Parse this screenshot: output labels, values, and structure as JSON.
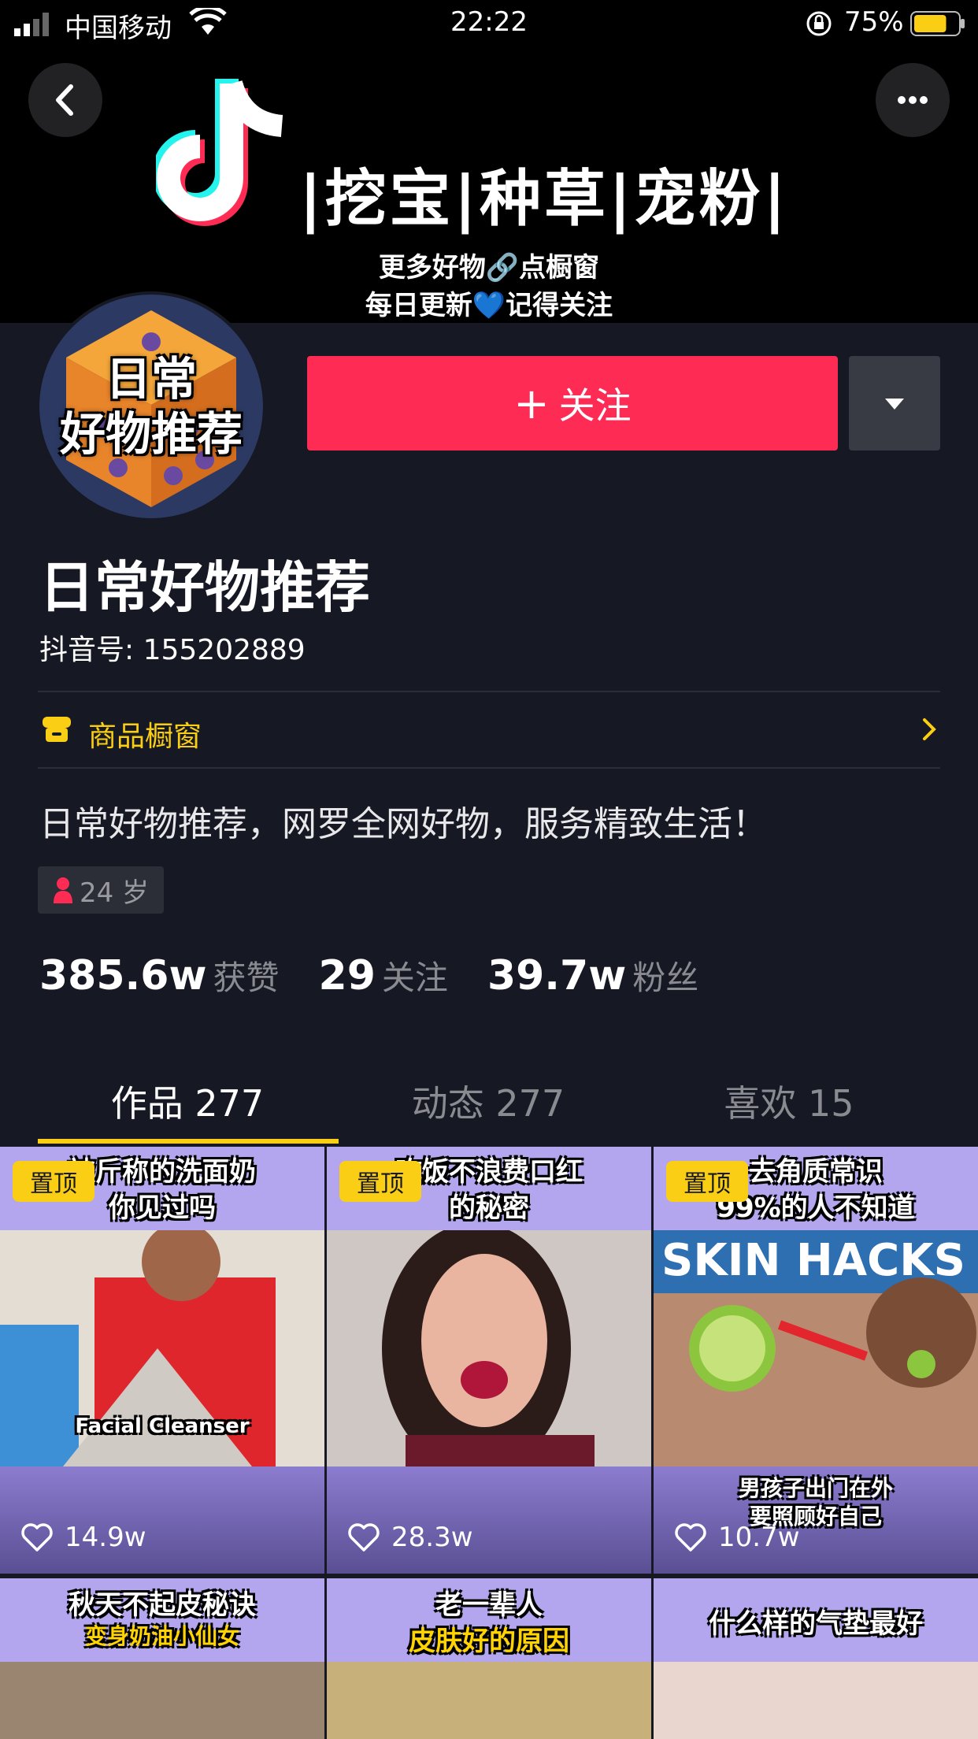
{
  "status_bar": {
    "carrier": "中国移动",
    "time": "22:22",
    "battery_percent": "75%",
    "battery_level": 0.75
  },
  "banner": {
    "title": "|挖宝|种草|宠粉|",
    "line1": "更多好物🔗点橱窗",
    "line2": "每日更新💙记得关注"
  },
  "avatar": {
    "line1": "日常",
    "line2": "好物推荐"
  },
  "follow": {
    "plus": "+",
    "label": "关注"
  },
  "profile": {
    "nickname": "日常好物推荐",
    "douyin_id": "抖音号: 155202889",
    "shop_label": "商品橱窗",
    "bio": "日常好物推荐，网罗全网好物，服务精致生活！",
    "age": "24 岁"
  },
  "stats": [
    {
      "value": "385.6w",
      "label": "获赞"
    },
    {
      "value": "29",
      "label": "关注"
    },
    {
      "value": "39.7w",
      "label": "粉丝"
    }
  ],
  "tabs": [
    {
      "label": "作品 277"
    },
    {
      "label": "动态 277"
    },
    {
      "label": "喜欢 15"
    }
  ],
  "videos": [
    {
      "caption1": "被斤称的洗面奶",
      "caption2": "你见过吗",
      "overlay": "Facial Cleanser",
      "pinned": "置顶",
      "likes": "14.9w"
    },
    {
      "caption1": "吃饭不浪费口红",
      "caption2": "的秘密",
      "overlay": "",
      "pinned": "置顶",
      "likes": "28.3w"
    },
    {
      "caption1": "去角质常识",
      "caption2": "99%的人不知道",
      "overlay": "SKIN HACKS",
      "bottom_caption1": "男孩子出门在外",
      "bottom_caption2": "要照顾好自己",
      "pinned": "置顶",
      "likes": "10.7w"
    },
    {
      "caption1": "秋天不起皮秘诀",
      "caption2": "变身奶油小仙女"
    },
    {
      "caption1": "老一辈人",
      "caption2": "皮肤好的原因"
    },
    {
      "caption1": "什么样的气垫最好",
      "caption2": ""
    }
  ],
  "colors": {
    "background": "#161823",
    "follow": "#fe2c55",
    "accent": "#face15"
  }
}
